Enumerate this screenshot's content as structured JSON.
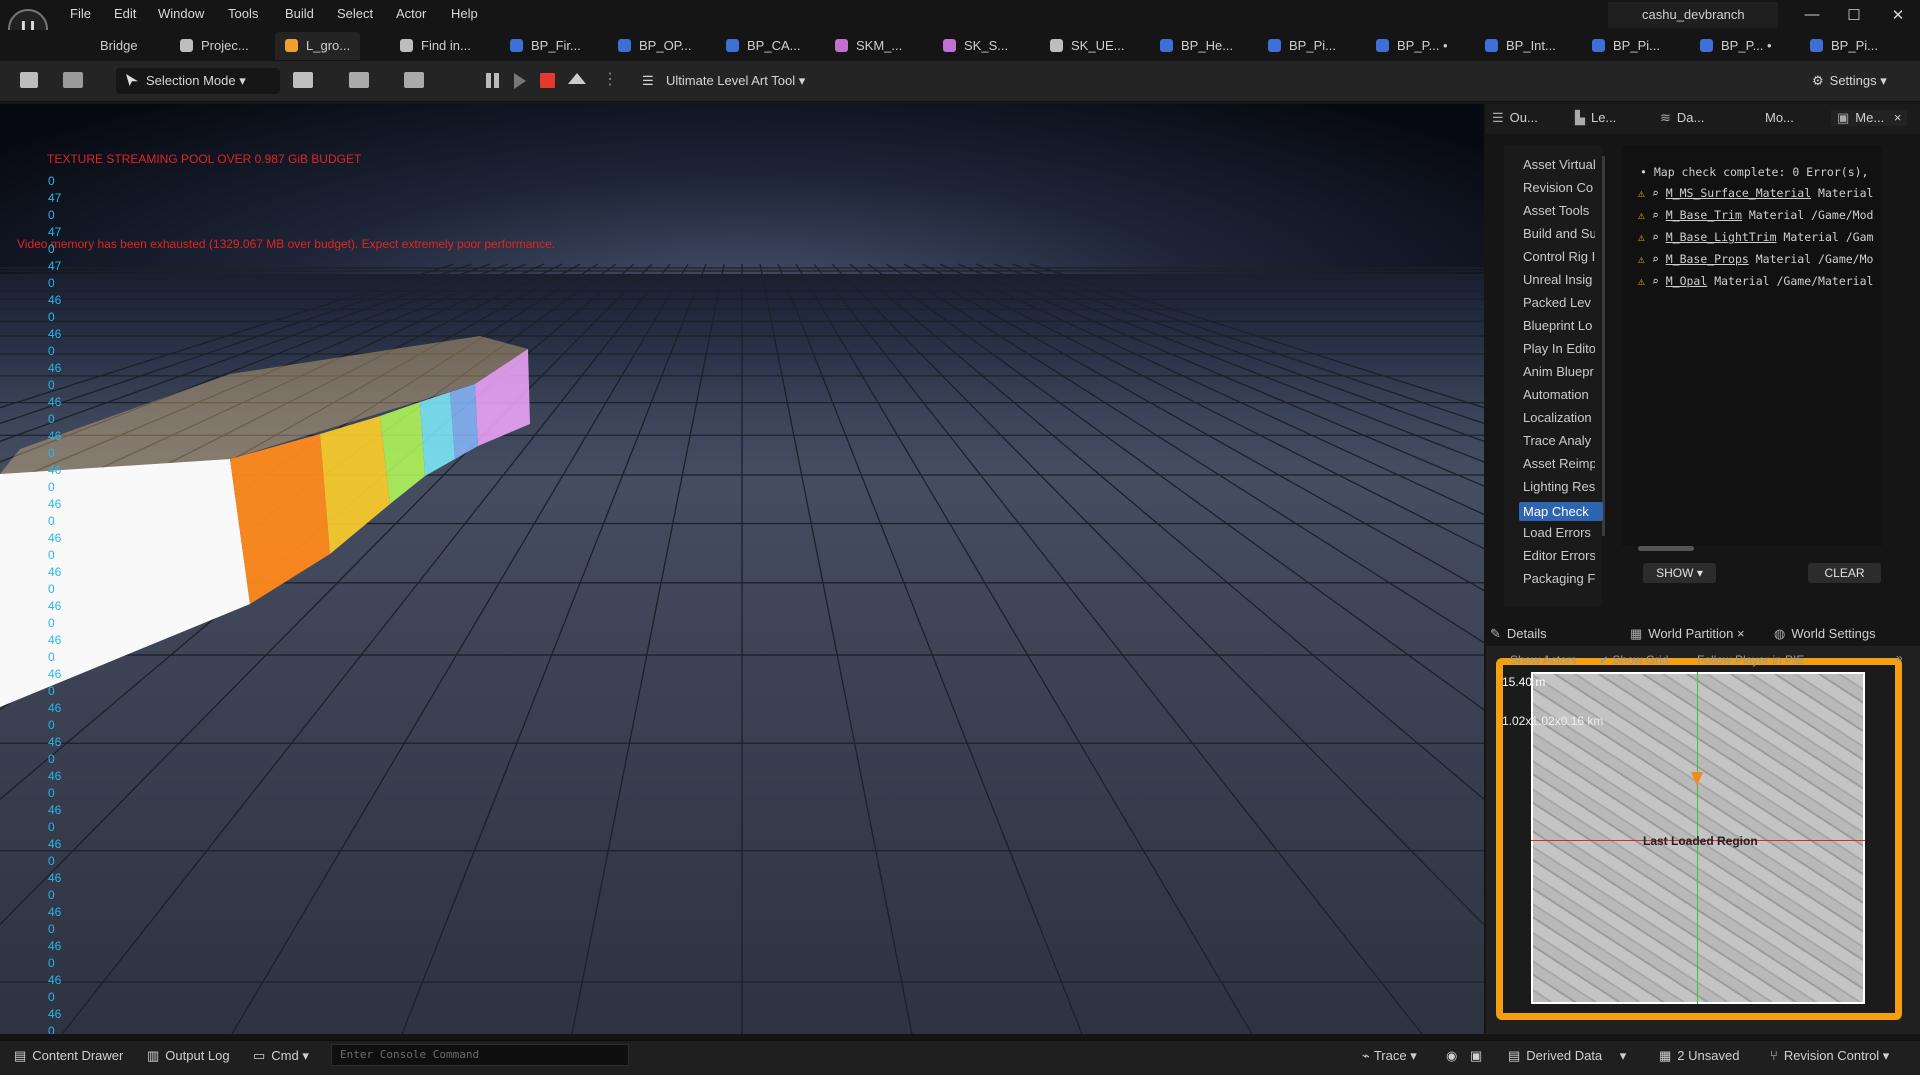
{
  "menu": [
    "File",
    "Edit",
    "Window",
    "Tools",
    "Build",
    "Select",
    "Actor",
    "Help"
  ],
  "branch": "cashu_devbranch",
  "window_controls": [
    "—",
    "☐",
    "✕"
  ],
  "tabs": [
    {
      "label": "Bridge",
      "color": "#bdbdbd"
    },
    {
      "label": "Projec...",
      "color": "#bdbdbd"
    },
    {
      "label": "L_gro...",
      "color": "#f0a030"
    },
    {
      "label": "Find in...",
      "color": "#bdbdbd"
    },
    {
      "label": "BP_Fir...",
      "color": "#3d6fd6"
    },
    {
      "label": "BP_OP...",
      "color": "#3d6fd6"
    },
    {
      "label": "BP_CA...",
      "color": "#3d6fd6"
    },
    {
      "label": "SKM_...",
      "color": "#c070d0"
    },
    {
      "label": "SK_S...",
      "color": "#c070d0"
    },
    {
      "label": "SK_UE...",
      "color": "#bdbdbd"
    },
    {
      "label": "BP_He...",
      "color": "#3d6fd6"
    },
    {
      "label": "BP_Pi...",
      "color": "#3d6fd6"
    },
    {
      "label": "BP_P... •",
      "color": "#3d6fd6"
    },
    {
      "label": "BP_Int...",
      "color": "#3d6fd6"
    },
    {
      "label": "BP_Pi...",
      "color": "#3d6fd6"
    },
    {
      "label": "BP_P... •",
      "color": "#3d6fd6"
    },
    {
      "label": "BP_Pi...",
      "color": "#3d6fd6"
    }
  ],
  "toolbar": {
    "selection_mode": "Selection Mode",
    "ult_tool": "Ultimate Level Art Tool",
    "settings": "Settings"
  },
  "viewport": {
    "warning1": "TEXTURE STREAMING POOL OVER 0.987 GiB BUDGET",
    "warning2": "Video memory has been exhausted (1329.067 MB over budget). Expect extremely poor performance.",
    "stat_numbers": [
      "0",
      "47",
      "0",
      "47",
      "0",
      "47",
      "0",
      "46",
      "0",
      "46",
      "0",
      "46",
      "0",
      "46",
      "0",
      "46",
      "0",
      "46",
      "0",
      "46",
      "0",
      "46",
      "0",
      "46",
      "0",
      "46",
      "0",
      "46",
      "0",
      "46",
      "0",
      "46",
      "0",
      "46",
      "0",
      "46",
      "0",
      "46",
      "0",
      "46",
      "0",
      "46",
      "0",
      "46",
      "0",
      "46",
      "0",
      "46",
      "0",
      "46",
      "0",
      "46",
      "0"
    ]
  },
  "right_tabs": [
    "Ou...",
    "Le...",
    "Da...",
    "Mo...",
    "Me..."
  ],
  "message_categories": [
    "Asset Virtual",
    "Revision Co",
    "Asset Tools",
    "Build and Su",
    "Control Rig I",
    "Unreal Insig",
    "Packed Lev",
    "Blueprint Lo",
    "Play In Edito",
    "Anim Bluepr",
    "Automation",
    "Localization",
    "Trace Analy",
    "Asset Reimp",
    "Lighting Res",
    "Map Check",
    "Load Errors",
    "Editor Errors",
    "Packaging F"
  ],
  "selected_category": "Map Check",
  "log": {
    "header": "• Map check complete: 0 Error(s),",
    "lines": [
      {
        "name": "M_MS_Surface_Material",
        "rest": " Material"
      },
      {
        "name": "M_Base_Trim",
        "rest": " Material /Game/Mod"
      },
      {
        "name": "M_Base_LightTrim",
        "rest": " Material /Gam"
      },
      {
        "name": "M_Base_Props",
        "rest": " Material /Game/Mo"
      },
      {
        "name": "M_Opal",
        "rest": " Material /Game/Material"
      }
    ],
    "show": "SHOW",
    "clear": "CLEAR"
  },
  "bottom_tabs": {
    "details": "Details",
    "world_partition": "World Partition",
    "world_settings": "World Settings"
  },
  "wp": {
    "show_actors": "Show Actors",
    "show_grid": "Show Grid",
    "follow_player": "Follow Player in PIE",
    "scale": "15.40 m",
    "size": "1.02x1.02x0.16 km",
    "region": "Last Loaded Region"
  },
  "status": {
    "content_drawer": "Content Drawer",
    "output_log": "Output Log",
    "cmd": "Cmd",
    "console_placeholder": "Enter Console Command",
    "trace": "Trace",
    "derived_data": "Derived Data",
    "unsaved": "2 Unsaved",
    "revision_control": "Revision Control"
  },
  "colors": {
    "accent_orange": "#f2a012",
    "warn_red": "#e02424",
    "stat_cyan": "#2cb5e8",
    "selection_blue": "#2e64b0"
  }
}
